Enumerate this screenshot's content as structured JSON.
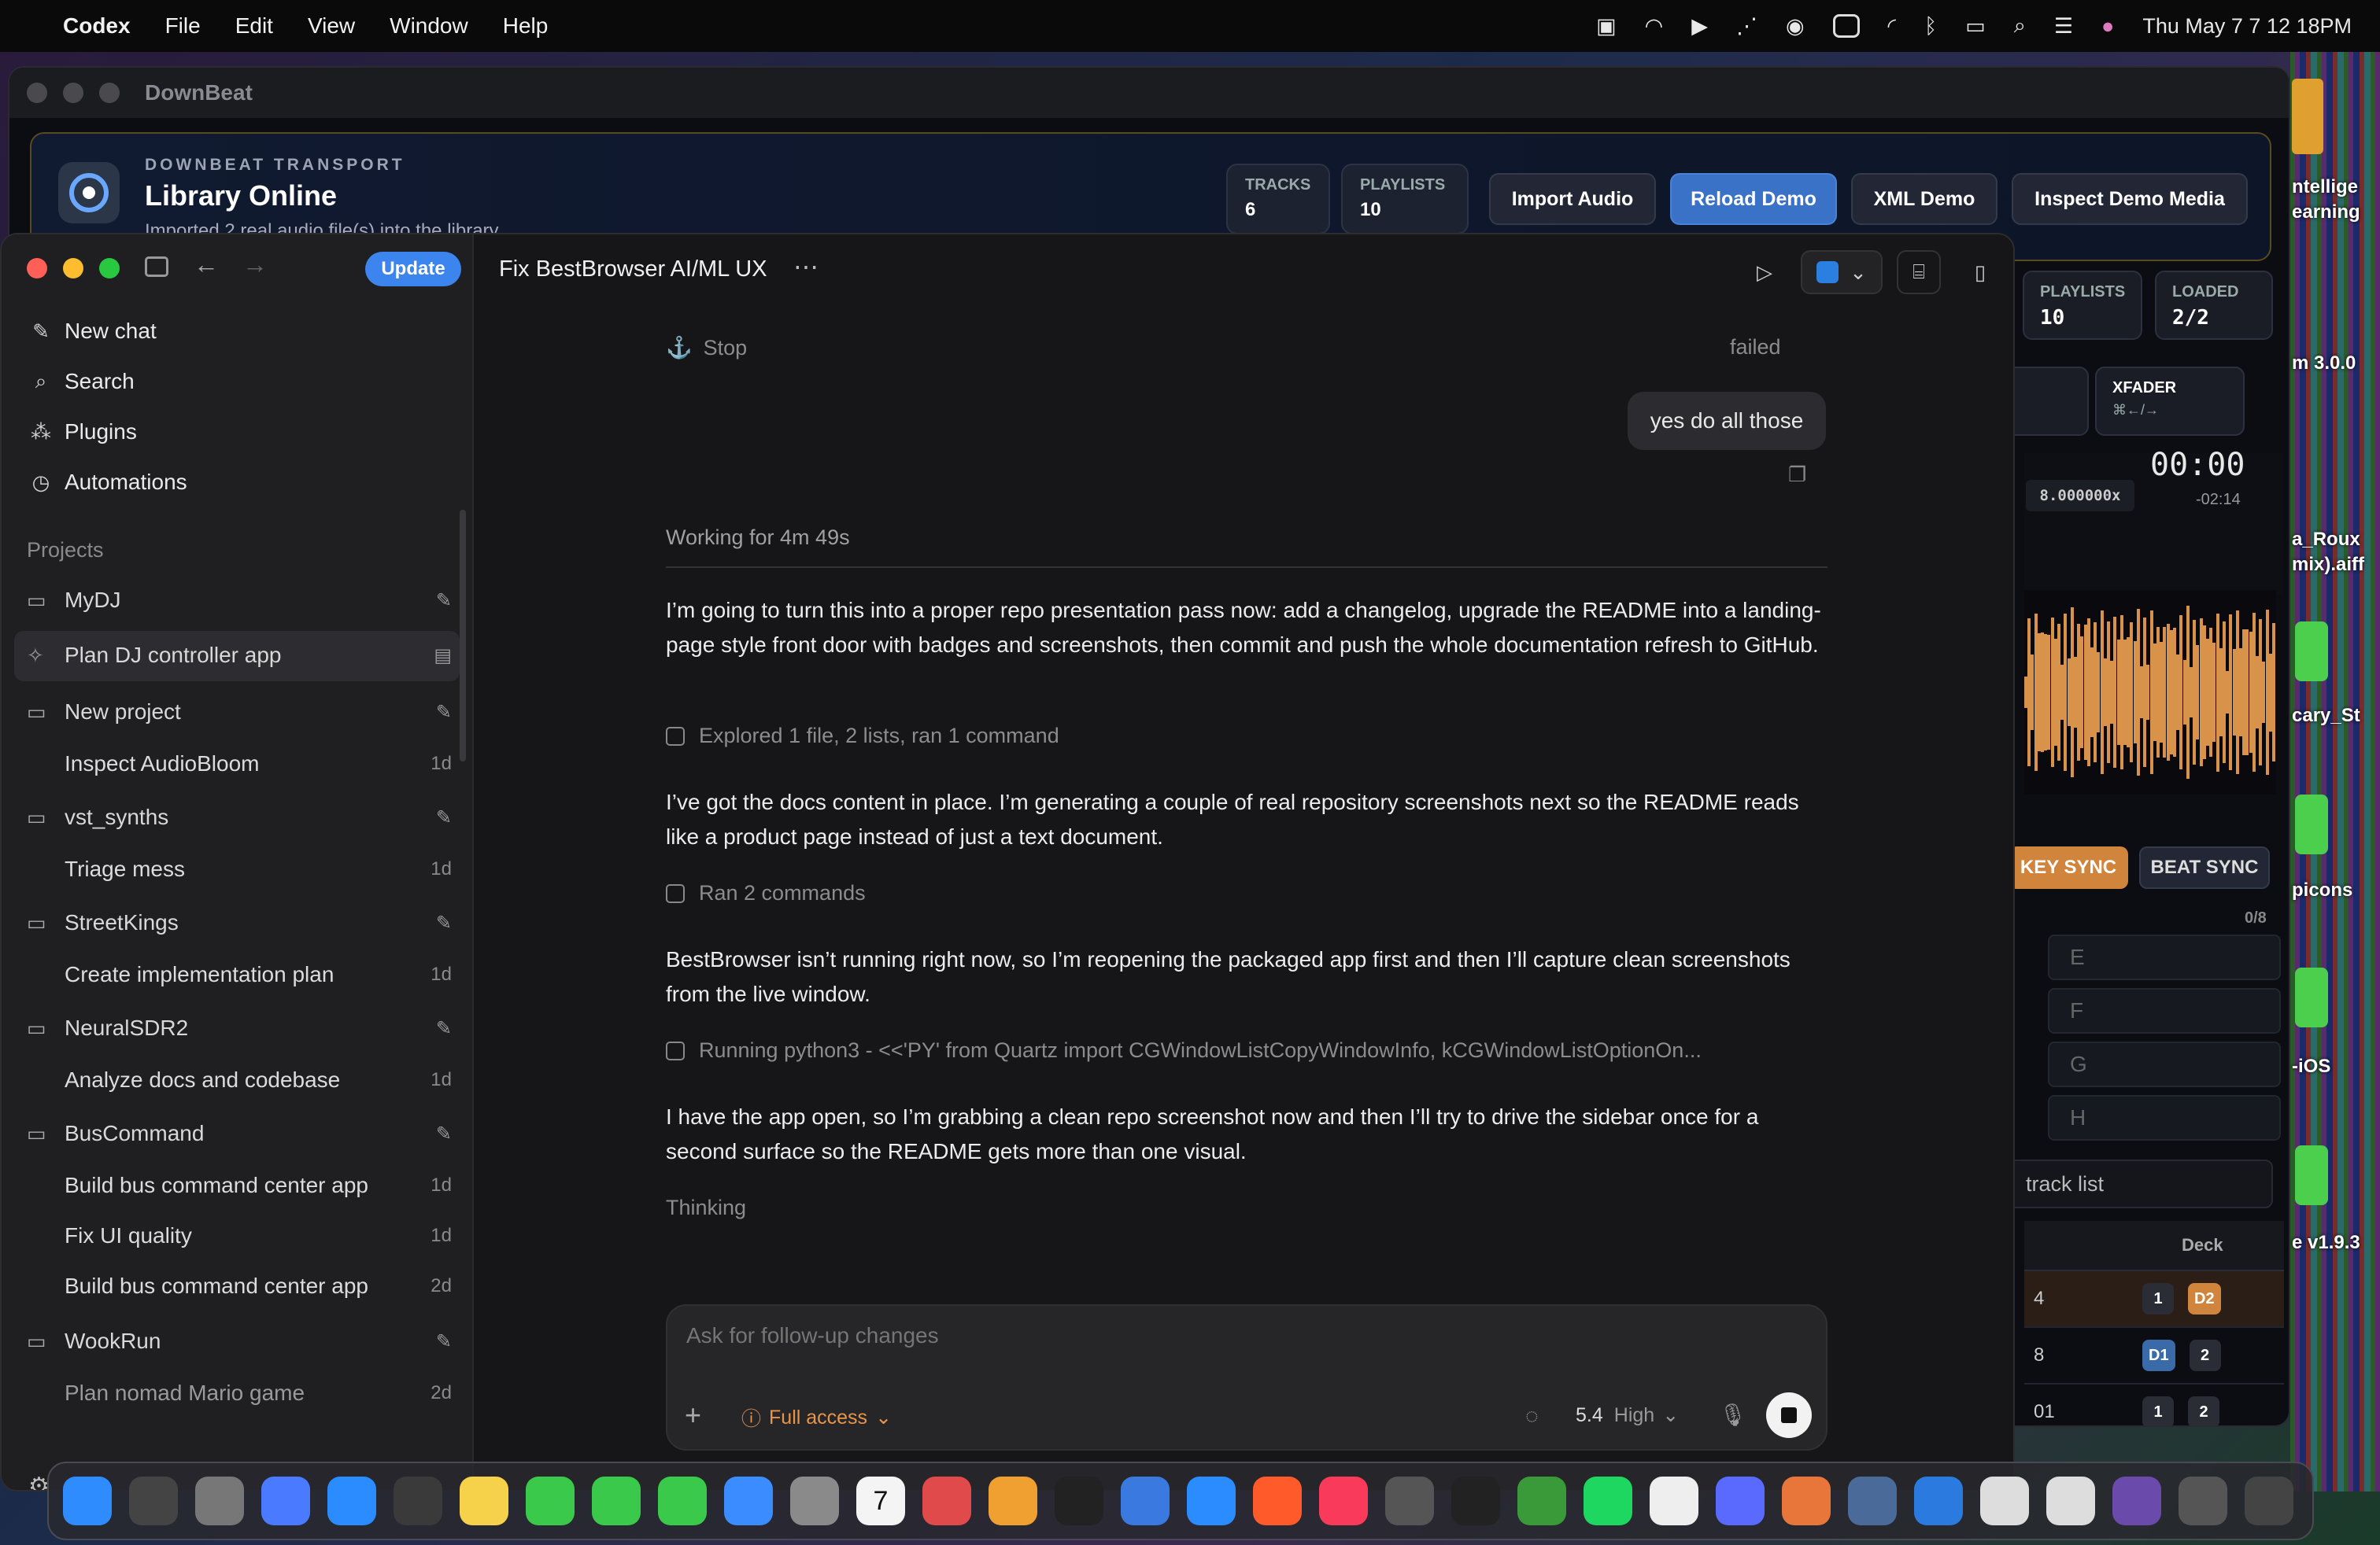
{
  "menubar": {
    "app_name": "Codex",
    "items": [
      "File",
      "Edit",
      "View",
      "Window",
      "Help"
    ],
    "clock": "Thu May 7  7 12 18PM"
  },
  "downbeat": {
    "window_title": "DownBeat",
    "kicker": "DOWNBEAT TRANSPORT",
    "heading": "Library Online",
    "subtitle": "Imported 2 real audio file(s) into the library.",
    "stats": [
      {
        "label": "TRACKS",
        "value": "6"
      },
      {
        "label": "PLAYLISTS",
        "value": "10"
      }
    ],
    "buttons": [
      "Import Audio",
      "Reload Demo",
      "XML Demo",
      "Inspect Demo Media"
    ],
    "panel": {
      "playlists_label": "PLAYLISTS",
      "playlists_value": "10",
      "loaded_label": "LOADED",
      "loaded_value": "2/2",
      "xfader_label": "XFADER",
      "xfader_hint": "⌘←/→",
      "time": "00:00",
      "remaining": "-02:14",
      "rate": "8.000000x",
      "key_sync": "KEY SYNC",
      "beat_sync": "BEAT SYNC",
      "counter": "0/8",
      "letters": [
        "E",
        "F",
        "G",
        "H"
      ],
      "search_placeholder": "track list",
      "deck_header": "Deck",
      "rows": [
        {
          "num": "4",
          "a": "1",
          "b": "D2"
        },
        {
          "num": "8",
          "a": "D1",
          "b": "2"
        },
        {
          "num": "01",
          "a": "1",
          "b": "2"
        }
      ]
    }
  },
  "desktop_labels": [
    "ntellige",
    "earning",
    "m 3.0.0",
    "a_Roux",
    "mix).aiff",
    "cary_St",
    "picons",
    "-iOS",
    "e v1.9.3"
  ],
  "codex": {
    "update_label": "Update",
    "nav": [
      {
        "icon": "new-chat-icon",
        "label": "New chat"
      },
      {
        "icon": "search-icon",
        "label": "Search"
      },
      {
        "icon": "plugins-icon",
        "label": "Plugins"
      },
      {
        "icon": "automations-icon",
        "label": "Automations"
      }
    ],
    "projects_heading": "Projects",
    "projects": [
      {
        "name": "MyDJ",
        "threads": [
          {
            "title": "Plan DJ controller app",
            "age": ""
          }
        ]
      },
      {
        "name": "New project",
        "threads": [
          {
            "title": "Inspect AudioBloom",
            "age": "1d"
          }
        ]
      },
      {
        "name": "vst_synths",
        "threads": [
          {
            "title": "Triage mess",
            "age": "1d"
          }
        ]
      },
      {
        "name": "StreetKings",
        "threads": [
          {
            "title": "Create implementation plan",
            "age": "1d"
          }
        ]
      },
      {
        "name": "NeuralSDR2",
        "threads": [
          {
            "title": "Analyze docs and codebase",
            "age": "1d"
          }
        ]
      },
      {
        "name": "BusCommand",
        "threads": [
          {
            "title": "Build bus command center app",
            "age": "1d"
          },
          {
            "title": "Fix UI quality",
            "age": "1d"
          },
          {
            "title": "Build bus command center app",
            "age": "2d"
          }
        ]
      },
      {
        "name": "WookRun",
        "threads": [
          {
            "title": "Plan nomad Mario game",
            "age": "2d"
          }
        ]
      }
    ],
    "chat": {
      "title": "Fix BestBrowser AI/ML UX",
      "stop_label": "Stop",
      "failed_label": "failed",
      "user_message": "yes do all those",
      "working_label": "Working for 4m 49s",
      "messages": [
        "I’m going to turn this into a proper repo presentation pass now: add a changelog, upgrade the README into a landing-page style front door with badges and screenshots, then commit and push the whole documentation refresh to GitHub.",
        "I’ve got the docs content in place. I’m generating a couple of real repository screenshots next so the README reads like a product page instead of just a text document.",
        "BestBrowser isn’t running right now, so I’m reopening the packaged app first and then I’ll capture clean screenshots from the live window.",
        "I have the app open, so I’m grabbing a clean repo screenshot now and then I’ll try to drive the sidebar once for a second surface so the README gets more than one visual."
      ],
      "tools": [
        "Explored 1 file, 2 lists, ran 1 command",
        "Ran 2 commands",
        "Running python3 - <<'PY' from Quartz import CGWindowListCopyWindowInfo, kCGWindowListOptionOn..."
      ],
      "thinking": "Thinking",
      "composer_placeholder": "Ask for follow-up changes",
      "access_label": "Full access",
      "model": "5.4",
      "effort": "High"
    }
  },
  "dock_icons": [
    "finder-icon",
    "launchpad-icon",
    "system-settings-icon",
    "simulator-icon",
    "app-store-icon",
    "reminders-icon",
    "notes-icon",
    "messages-icon",
    "facetime-icon",
    "phone-icon",
    "mail-icon",
    "contacts-icon",
    "calendar-icon",
    "rocket-icon",
    "photos-icon",
    "tv-icon",
    "instruments-icon",
    "safari-icon",
    "brave-icon",
    "music-icon",
    "affinity-icon",
    "terminal-icon",
    "game-icon",
    "spotify-icon",
    "file-icon",
    "chat-icon",
    "claude-icon",
    "pixel-icon",
    "xcode-icon",
    "blank-icon",
    "document-icon",
    "photo-stack-icon",
    "screenshot-icon",
    "trash-icon"
  ],
  "calendar_day": "7"
}
